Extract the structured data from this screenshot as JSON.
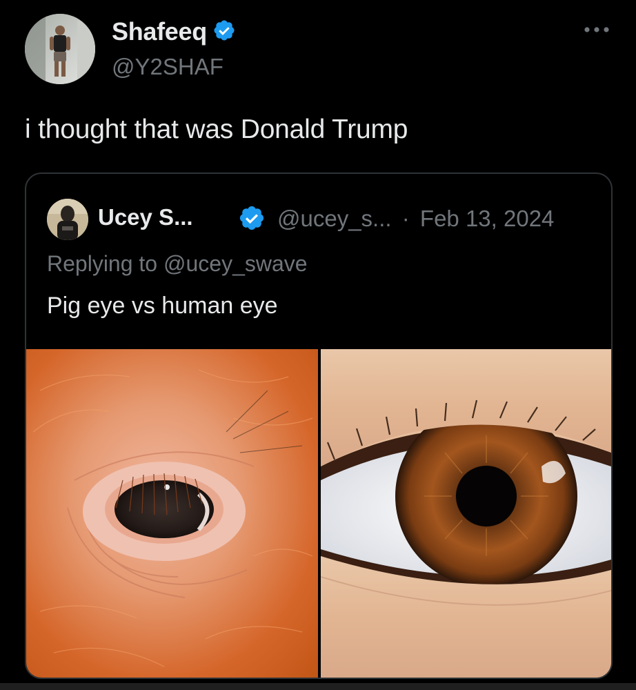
{
  "author": {
    "display_name": "Shafeeq",
    "handle": "@Y2SHAF",
    "verified_icon": "verified-badge-icon"
  },
  "more_icon": "more-horizontal-icon",
  "tweet": {
    "text": "i thought that was Donald Trump"
  },
  "quoted": {
    "display_name": "Ucey S...",
    "handle": "@ucey_s...",
    "separator": "·",
    "date": "Feb 13, 2024",
    "reply_prefix": "Replying to ",
    "reply_to": "@ucey_swave",
    "text": "Pig eye vs human eye",
    "media": [
      {
        "name": "pig-eye-photo",
        "subject": "pig eye"
      },
      {
        "name": "human-eye-photo",
        "subject": "human eye"
      }
    ]
  },
  "colors": {
    "background": "#000000",
    "text_primary": "#e7e9ea",
    "text_secondary": "#71767b",
    "border": "#2f3336",
    "verified_blue": "#1d9bf0"
  }
}
